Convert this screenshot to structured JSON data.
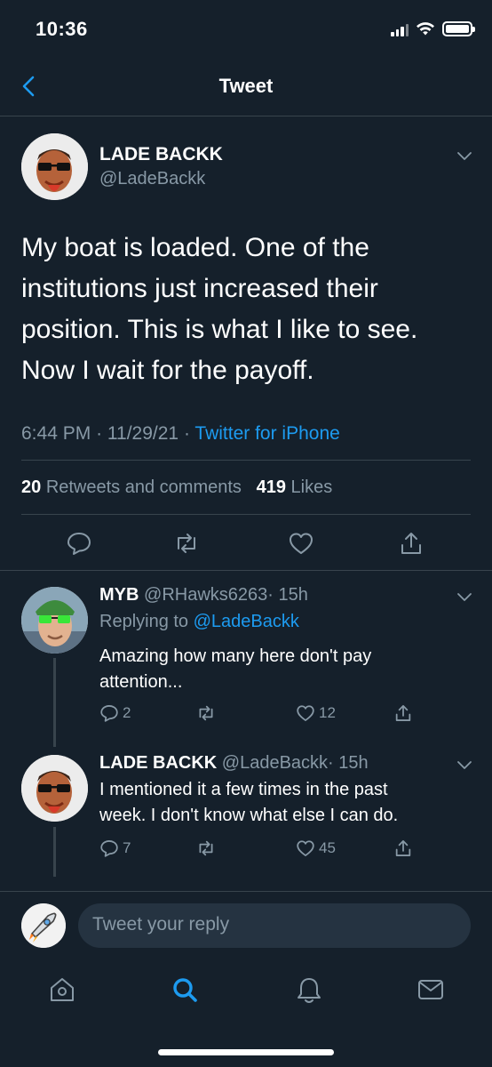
{
  "status_bar": {
    "time": "10:36"
  },
  "header": {
    "title": "Tweet"
  },
  "tweet": {
    "author_name": "LADE BACKK",
    "author_handle": "@LadeBackk",
    "text": "My boat is loaded. One of the institutions just increased their position. This is what I like to see. Now I wait for the payoff.",
    "time": "6:44 PM",
    "date": "11/29/21",
    "sep": "·",
    "source": "Twitter for iPhone",
    "retweets_count": "20",
    "retweets_label": "Retweets and comments",
    "likes_count": "419",
    "likes_label": "Likes"
  },
  "replies": [
    {
      "author_name": "MYB",
      "author_handle": "@RHawks6263",
      "age": "· 15h",
      "replying_label": "Replying to",
      "replying_to": "@LadeBackk",
      "text_line1": "Amazing how many here don't pay",
      "text_line2": "attention...",
      "reply_count": "2",
      "like_count": "12"
    },
    {
      "author_name": "LADE BACKK",
      "author_handle": "@LadeBackk",
      "age": "· 15h",
      "text_line1": "I mentioned it a few times in the past",
      "text_line2": "week. I don't know what else I can do.",
      "reply_count": "7",
      "like_count": "45"
    }
  ],
  "composer": {
    "placeholder": "Tweet your reply"
  },
  "tab_bar": {
    "items": [
      "home-icon",
      "search-icon",
      "notifications-icon",
      "messages-icon"
    ],
    "active": "search-icon"
  },
  "colors": {
    "background": "#15202b",
    "accent": "#1d9bf0",
    "muted": "#8899a6",
    "divider": "#38444d"
  }
}
